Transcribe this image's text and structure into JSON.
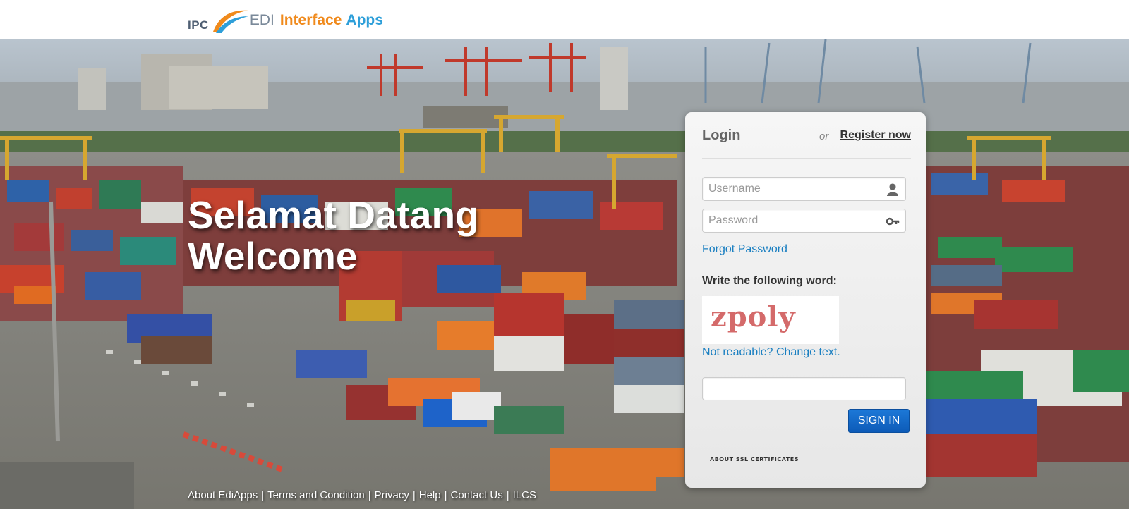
{
  "header": {
    "logo_ipc": "IPC",
    "logo_edi": "EDI",
    "logo_interface": "Interface",
    "logo_apps": "Apps"
  },
  "hero": {
    "line1": "Selamat Datang",
    "line2": "Welcome"
  },
  "login": {
    "title": "Login",
    "or": "or",
    "register_label": "Register now",
    "username_placeholder": "Username",
    "password_placeholder": "Password",
    "forgot_label": "Forgot Password",
    "captcha_label": "Write the following word:",
    "captcha_word": "zpoly",
    "change_text_label": "Not readable? Change text.",
    "answer_value": "",
    "signin_label": "SIGN IN",
    "ssl_label": "ABOUT SSL CERTIFICATES"
  },
  "footer": {
    "links": [
      "About EdiApps",
      "Terms and Condition",
      "Privacy",
      "Help",
      "Contact Us",
      "ILCS"
    ],
    "separator": "|"
  },
  "colors": {
    "accent_blue": "#1a7fc1",
    "signin_blue": "#0d5bb8",
    "logo_orange": "#f08a1c",
    "logo_blue": "#2e9fd9"
  },
  "icons": {
    "username": "user-icon",
    "password": "key-icon"
  }
}
